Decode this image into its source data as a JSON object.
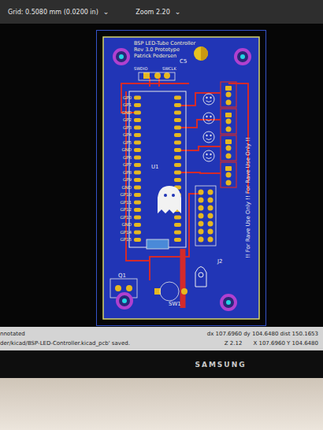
{
  "toolbar": {
    "grid": {
      "label": "Grid: 0.5080 mm (0.0200 in)",
      "arrow": "⌄"
    },
    "zoom": {
      "label": "Zoom 2.20",
      "arrow": "⌄"
    }
  },
  "board": {
    "title_lines": [
      "BSP LED-Tube Controller",
      "Rev 3.0 Prototype",
      "Patrick Pedersen"
    ],
    "swd_labels": [
      "SWDIO",
      "SWCLK"
    ],
    "references": [
      "C5",
      "U1",
      "J2",
      "Q1",
      "SW1"
    ],
    "left_pin_labels": [
      "GP0",
      "GP1",
      "GND",
      "GP2",
      "GP3",
      "GP4",
      "GP5",
      "GND",
      "GP6",
      "GP7",
      "GP8",
      "GP9",
      "GND",
      "GP10",
      "GP11",
      "GP12",
      "GP13",
      "GND",
      "GP14",
      "GP15"
    ],
    "warning": "!! For Rave Use Only !! For Rave Use Only !!"
  },
  "status_bar": {
    "messages": [
      "nnotated",
      "der/kicad/BSP-LED-Controller.kicad_pcb' saved."
    ],
    "zoom": "Z 2.12",
    "cursor": "X 107.6960 Y 104.6480",
    "delta": "dx 107.6960 dy 104.6480 dist 150.1653"
  },
  "monitor": {
    "brand": "SAMSUNG"
  }
}
